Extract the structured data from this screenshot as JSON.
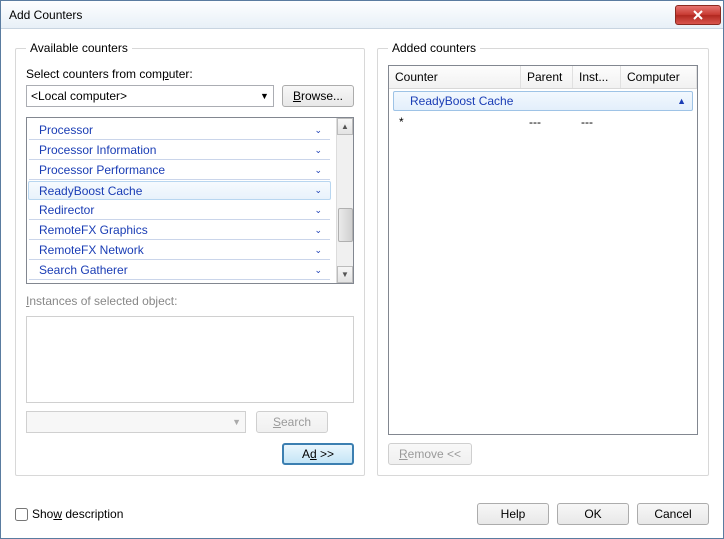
{
  "titlebar": {
    "title": "Add Counters"
  },
  "left": {
    "legend": "Available counters",
    "select_label_pre": "Select counters from com",
    "select_label_u": "p",
    "select_label_post": "uter:",
    "computer_value": "<Local computer>",
    "browse_u": "B",
    "browse_rest": "rowse...",
    "counters": [
      "Processor",
      "Processor Information",
      "Processor Performance",
      "ReadyBoost Cache",
      "Redirector",
      "RemoteFX Graphics",
      "RemoteFX Network",
      "Search Gatherer"
    ],
    "selected_index": 3,
    "instances_u": "I",
    "instances_rest": "nstances of selected object:",
    "search_u": "S",
    "search_rest": "earch",
    "add_u": "d",
    "add_pre": "A",
    "add_post": " >>"
  },
  "right": {
    "legend": "Added counters",
    "columns": [
      "Counter",
      "Parent",
      "Inst...",
      "Computer"
    ],
    "group": "ReadyBoost Cache",
    "rows": [
      {
        "counter": "*",
        "parent": "---",
        "inst": "---",
        "computer": ""
      }
    ],
    "remove_u": "R",
    "remove_rest": "emove <<"
  },
  "footer": {
    "show_desc_pre": "Sho",
    "show_desc_u": "w",
    "show_desc_post": " description",
    "help": "Help",
    "ok": "OK",
    "cancel": "Cancel"
  }
}
